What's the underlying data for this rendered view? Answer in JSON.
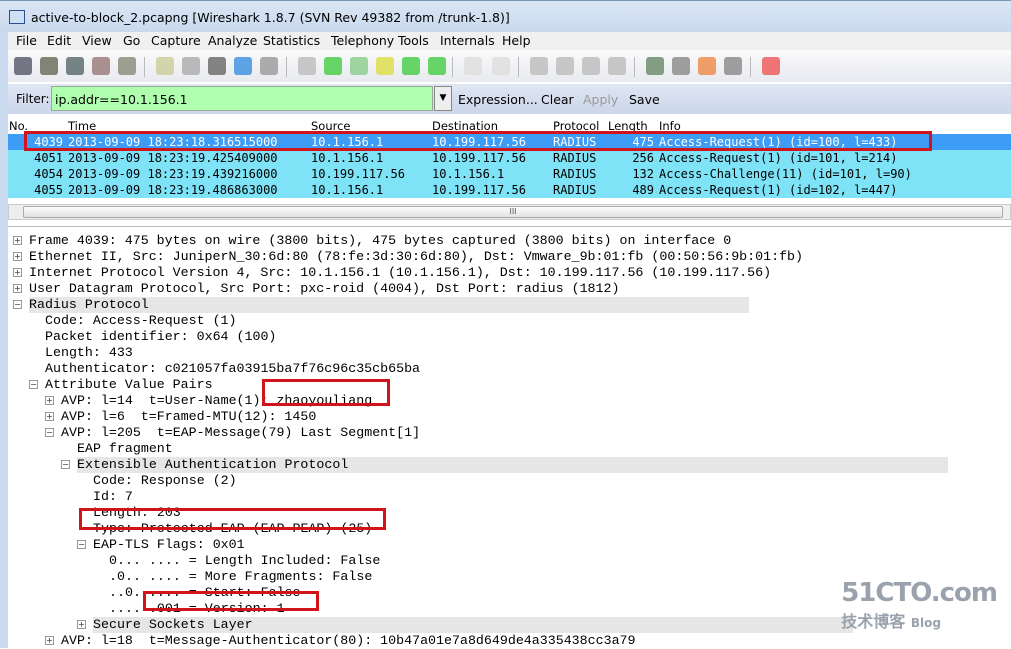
{
  "window": {
    "title": "active-to-block_2.pcapng   [Wireshark 1.8.7  (SVN Rev 49382 from /trunk-1.8)]"
  },
  "menu": [
    "File",
    "Edit",
    "View",
    "Go",
    "Capture",
    "Analyze",
    "Statistics",
    "Telephony",
    "Tools",
    "Internals",
    "Help"
  ],
  "toolbar": [
    "interface-list",
    "capture-options",
    "start-capture",
    "stop-capture",
    "restart-capture",
    "open-file",
    "save-file",
    "close-file",
    "reload-file",
    "print",
    "find-packet",
    "go-back",
    "go-forward",
    "go-to-packet",
    "go-first",
    "go-last",
    "colorize",
    "auto-scroll",
    "zoom-in",
    "zoom-out",
    "normal-size",
    "resize-columns",
    "capture-filters",
    "display-filters",
    "coloring-rules",
    "preferences",
    "help"
  ],
  "filter": {
    "label": "Filter:",
    "value": "ip.addr==10.1.156.1",
    "expression": "Expression...",
    "clear": "Clear",
    "apply": "Apply",
    "save": "Save"
  },
  "packet_list": {
    "columns": [
      "No.",
      "Time",
      "Source",
      "Destination",
      "Protocol",
      "Length",
      "Info"
    ],
    "rows": [
      {
        "no": "4039",
        "time": "2013-09-09 18:23:18.316515000",
        "src": "10.1.156.1",
        "dst": "10.199.117.56",
        "proto": "RADIUS",
        "len": "475",
        "info": "Access-Request(1) (id=100, l=433)",
        "selected": true
      },
      {
        "no": "4051",
        "time": "2013-09-09 18:23:19.425409000",
        "src": "10.1.156.1",
        "dst": "10.199.117.56",
        "proto": "RADIUS",
        "len": "256",
        "info": "Access-Request(1) (id=101, l=214)"
      },
      {
        "no": "4054",
        "time": "2013-09-09 18:23:19.439216000",
        "src": "10.199.117.56",
        "dst": "10.1.156.1",
        "proto": "RADIUS",
        "len": "132",
        "info": "Access-Challenge(11) (id=101, l=90)"
      },
      {
        "no": "4055",
        "time": "2013-09-09 18:23:19.486863000",
        "src": "10.1.156.1",
        "dst": "10.199.117.56",
        "proto": "RADIUS",
        "len": "489",
        "info": "Access-Request(1) (id=102, l=447)"
      }
    ]
  },
  "details": [
    {
      "lvl": 0,
      "tog": "+",
      "text": "Frame 4039: 475 bytes on wire (3800 bits), 475 bytes captured (3800 bits) on interface 0"
    },
    {
      "lvl": 0,
      "tog": "+",
      "text": "Ethernet II, Src: JuniperN_30:6d:80 (78:fe:3d:30:6d:80), Dst: Vmware_9b:01:fb (00:50:56:9b:01:fb)"
    },
    {
      "lvl": 0,
      "tog": "+",
      "text": "Internet Protocol Version 4, Src: 10.1.156.1 (10.1.156.1), Dst: 10.199.117.56 (10.199.117.56)"
    },
    {
      "lvl": 0,
      "tog": "+",
      "text": "User Datagram Protocol, Src Port: pxc-roid (4004), Dst Port: radius (1812)"
    },
    {
      "lvl": 0,
      "tog": "-",
      "text": "Radius Protocol",
      "hl": true
    },
    {
      "lvl": 1,
      "text": "Code: Access-Request (1)"
    },
    {
      "lvl": 1,
      "text": "Packet identifier: 0x64 (100)"
    },
    {
      "lvl": 1,
      "text": "Length: 433"
    },
    {
      "lvl": 1,
      "text": "Authenticator: c021057fa03915ba7f76c96c35cb65ba"
    },
    {
      "lvl": 1,
      "tog": "-",
      "text": "Attribute Value Pairs"
    },
    {
      "lvl": 2,
      "tog": "+",
      "text": "AVP: l=14  t=User-Name(1): zhaoyouliang"
    },
    {
      "lvl": 2,
      "tog": "+",
      "text": "AVP: l=6  t=Framed-MTU(12): 1450"
    },
    {
      "lvl": 2,
      "tog": "-",
      "text": "AVP: l=205  t=EAP-Message(79) Last Segment[1]"
    },
    {
      "lvl": 3,
      "text": "EAP fragment"
    },
    {
      "lvl": 3,
      "tog": "-",
      "text": "Extensible Authentication Protocol",
      "hl": true
    },
    {
      "lvl": 4,
      "text": "Code: Response (2)"
    },
    {
      "lvl": 4,
      "text": "Id: 7"
    },
    {
      "lvl": 4,
      "text": "Length: 203"
    },
    {
      "lvl": 4,
      "text": "Type: Protected EAP (EAP-PEAP) (25)"
    },
    {
      "lvl": 4,
      "tog": "-",
      "text": "EAP-TLS Flags: 0x01"
    },
    {
      "lvl": 5,
      "text": "0... .... = Length Included: False"
    },
    {
      "lvl": 5,
      "text": ".0.. .... = More Fragments: False"
    },
    {
      "lvl": 5,
      "text": "..0. .... = Start: False"
    },
    {
      "lvl": 5,
      "text": ".... .001 = Version: 1"
    },
    {
      "lvl": 4,
      "tog": "+",
      "text": "Secure Sockets Layer",
      "hl": true
    },
    {
      "lvl": 2,
      "tog": "+",
      "text": "AVP: l=18  t=Message-Authenticator(80): 10b47a01e7a8d649de4a335438cc3a79"
    }
  ],
  "watermark": {
    "main": "51CTO.com",
    "sub": "技术博客",
    "blog": "Blog"
  },
  "colors": {
    "selected_row": "#3d9cf5",
    "radius_row": "#7fe3f8",
    "filter_ok": "#afffaf",
    "annotation": "#d0141c"
  }
}
